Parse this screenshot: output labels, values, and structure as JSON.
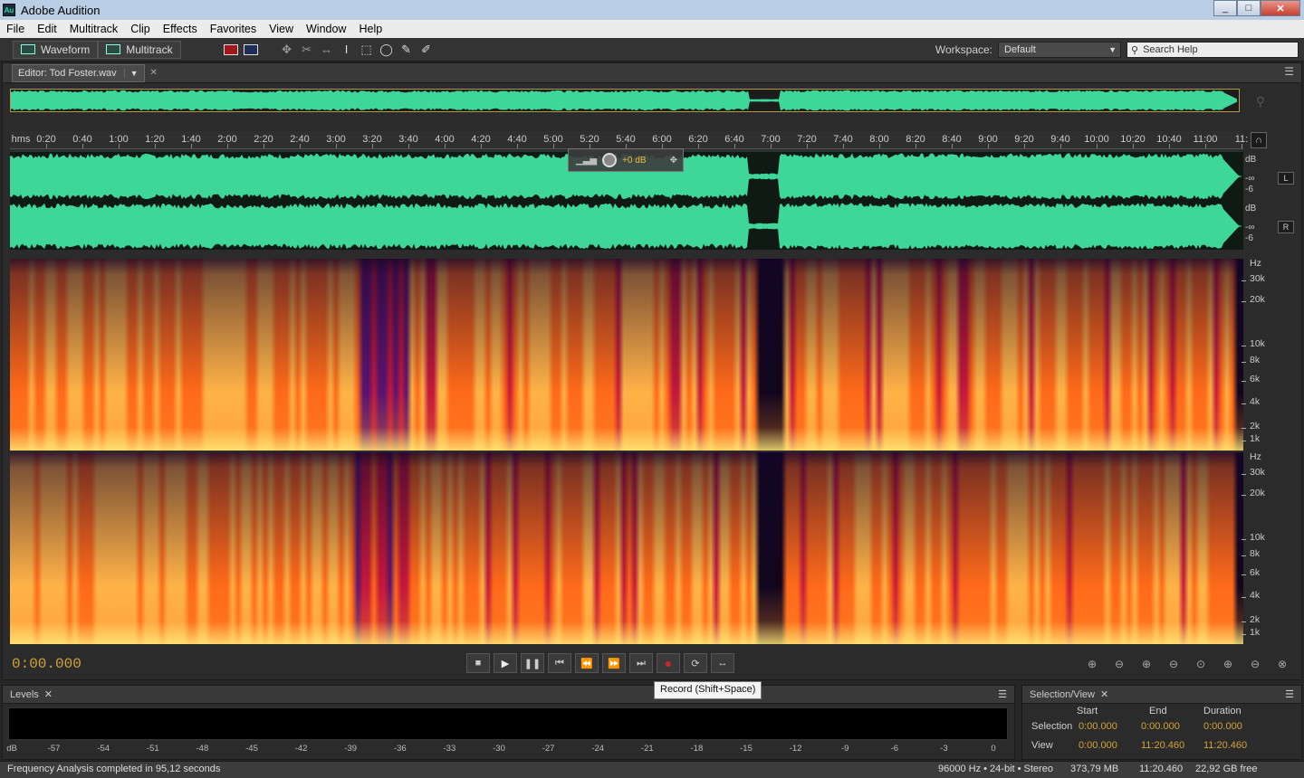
{
  "window": {
    "title": "Adobe Audition",
    "app_icon_text": "Au",
    "min": "_",
    "max": "□",
    "close": "✕"
  },
  "menu": [
    "File",
    "Edit",
    "Multitrack",
    "Clip",
    "Effects",
    "Favorites",
    "View",
    "Window",
    "Help"
  ],
  "toolbar": {
    "waveform_label": "Waveform",
    "multitrack_label": "Multitrack",
    "workspace_label": "Workspace:",
    "workspace_value": "Default",
    "search_placeholder": "Search Help"
  },
  "editor": {
    "tab_label": "Editor: Tod Foster.wav",
    "ruler_unit": "hms",
    "ruler_ticks": [
      "0:20",
      "0:40",
      "1:00",
      "1:20",
      "1:40",
      "2:00",
      "2:20",
      "2:40",
      "3:00",
      "3:20",
      "3:40",
      "4:00",
      "4:20",
      "4:40",
      "5:00",
      "5:20",
      "5:40",
      "6:00",
      "6:20",
      "6:40",
      "7:00",
      "7:20",
      "7:40",
      "8:00",
      "8:20",
      "8:40",
      "9:00",
      "9:20",
      "9:40",
      "10:00",
      "10:20",
      "10:40",
      "11:00",
      "11:"
    ],
    "hud_value": "+0 dB",
    "channel_left": "L",
    "channel_right": "R",
    "amp_labels": [
      "dB",
      "-∞",
      "-6"
    ],
    "hz_labels": [
      "Hz",
      "30k",
      "20k",
      "10k",
      "8k",
      "6k",
      "4k",
      "2k",
      "1k"
    ],
    "timecode": "0:00.000"
  },
  "transport_tooltip": "Record (Shift+Space)",
  "levels": {
    "title": "Levels",
    "scale": [
      "dB",
      "-57",
      "-54",
      "-51",
      "-48",
      "-45",
      "-42",
      "-39",
      "-36",
      "-33",
      "-30",
      "-27",
      "-24",
      "-21",
      "-18",
      "-15",
      "-12",
      "-9",
      "-6",
      "-3",
      "0"
    ]
  },
  "selection_view": {
    "title": "Selection/View",
    "col_start": "Start",
    "col_end": "End",
    "col_duration": "Duration",
    "row_selection": "Selection",
    "row_view": "View",
    "sel_start": "0:00.000",
    "sel_end": "0:00.000",
    "sel_duration": "0:00.000",
    "view_start": "0:00.000",
    "view_end": "11:20.460",
    "view_duration": "11:20.460"
  },
  "status": {
    "message": "Frequency Analysis completed in 95,12 seconds",
    "format": "96000 Hz • 24-bit • Stereo",
    "size": "373,79 MB",
    "duration": "11:20.460",
    "free": "22,92 GB free"
  },
  "colors": {
    "waveform": "#3fd69a",
    "accent": "#d4a43a",
    "titlebar": "#b9cde5"
  }
}
